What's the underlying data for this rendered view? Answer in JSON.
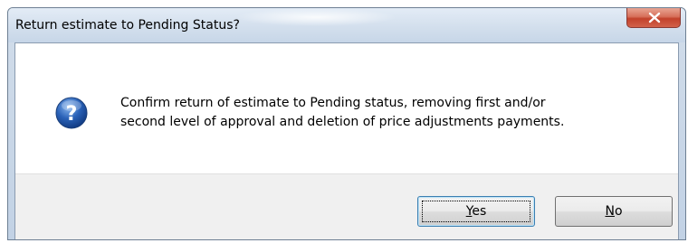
{
  "dialog": {
    "title": "Return estimate to Pending Status?",
    "close_icon": "close-icon",
    "icon": "question-icon",
    "message": "Confirm return of estimate to Pending status, removing first and/or\nsecond level of approval and deletion of price adjustments payments.",
    "buttons": {
      "yes": {
        "mnemonic": "Y",
        "rest": "es"
      },
      "no": {
        "mnemonic": "N",
        "rest": "o"
      }
    }
  },
  "colors": {
    "close_button": "#c2412b",
    "icon_blue": "#2a62b8",
    "button_area": "#f0f0f0"
  }
}
